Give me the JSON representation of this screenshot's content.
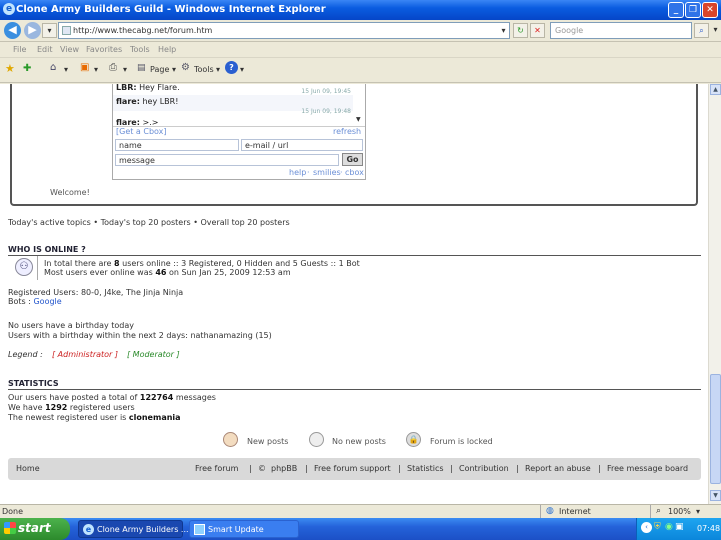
{
  "window": {
    "title": "Clone Army Builders Guild - Windows Internet Explorer"
  },
  "address": {
    "url": "http://www.thecabg.net/forum.htm",
    "search_placeholder": "Google"
  },
  "menu": [
    "File",
    "Edit",
    "View",
    "Favorites",
    "Tools",
    "Help"
  ],
  "toolbar": {
    "page": "Page",
    "tools": "Tools"
  },
  "cbox": {
    "messages": [
      {
        "user": "LBR:",
        "text": " Hey Flare.",
        "time": ""
      },
      {
        "user": "flare:",
        "text": " hey LBR!",
        "time": "15 Jun 09, 19:45"
      },
      {
        "user": "flare:",
        "text": " >.>",
        "time": "15 Jun 09, 19:48"
      }
    ],
    "get_link": "[Get a Cbox]",
    "refresh": "refresh",
    "name_placeholder": "name",
    "email_placeholder": "e-mail / url",
    "message_placeholder": "message",
    "go": "Go",
    "help": "help",
    "smilies": "smilies",
    "cbox": "cbox",
    "sep": "·"
  },
  "welcome": "Welcome!",
  "topics_line": "Today's active topics • Today's top 20 posters • Overall top 20 posters",
  "online": {
    "heading": "WHO IS ONLINE ?",
    "line1_a": "In total there are ",
    "line1_b": "8",
    "line1_c": " users online :: 3 Registered, 0 Hidden and 5 Guests :: 1 Bot",
    "line2_a": "Most users ever online was ",
    "line2_b": "46",
    "line2_c": " on Sun Jan 25, 2009 12:53 am",
    "registered": "Registered Users: 80-0, J4ke, The Jinja Ninja",
    "bots_label": "Bots : ",
    "bots_value": "Google",
    "birthday1": "No users have a birthday today",
    "birthday2": "Users with a birthday within the next 2 days: nathanamazing (15)",
    "legend_label": "Legend :",
    "legend_admin": "[ Administrator ]",
    "legend_mod": "[ Moderator ]"
  },
  "stats": {
    "heading": "STATISTICS",
    "l1_a": "Our users have posted a total of ",
    "l1_b": "122764",
    "l1_c": " messages",
    "l2_a": "We have ",
    "l2_b": "1292",
    "l2_c": " registered users",
    "l3_a": "The newest registered user is ",
    "l3_b": "clonemania"
  },
  "legend_icons": {
    "new": "New posts",
    "none": "No new posts",
    "locked": "Forum is locked"
  },
  "footer": {
    "home": "Home",
    "free_forum": "Free forum",
    "sep": "|",
    "copy": "©",
    "phpbb": "phpBB",
    "support": "Free forum support",
    "statistics": "Statistics",
    "contribution": "Contribution",
    "abuse": "Report an abuse",
    "message_board": "Free message board"
  },
  "status": {
    "left": "Done",
    "zone": "Internet",
    "zoom": "100%"
  },
  "taskbar": {
    "start": "start",
    "task1": "Clone Army Builders ...",
    "task2": "Smart Update",
    "clock": "07:48"
  }
}
